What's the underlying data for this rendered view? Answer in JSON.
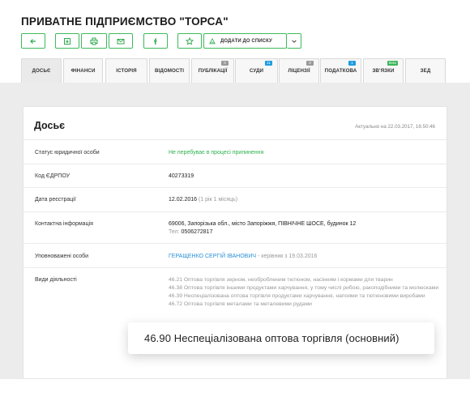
{
  "page": {
    "title": "ПРИВАТНЕ ПІДПРИЄМСТВО \"ТОРСА\""
  },
  "toolbar": {
    "add_to_list": "ДОДАТИ ДО СПИСКУ",
    "icons": [
      "back-arrow-icon",
      "download-icon",
      "print-icon",
      "email-icon",
      "facebook-icon",
      "star-icon",
      "list-icon",
      "chevron-down-icon"
    ]
  },
  "tabs": [
    {
      "label": "ДОСЬЄ",
      "active": true
    },
    {
      "label": "ФІНАНСИ"
    },
    {
      "label": "ІСТОРІЯ"
    },
    {
      "label": "ВІДОМОСТІ"
    },
    {
      "label": "ПУБЛІКАЦІЇ",
      "badge": "0"
    },
    {
      "label": "СУДИ",
      "badge": "11"
    },
    {
      "label": "ЛІЦЕНЗІЇ",
      "badge": "0"
    },
    {
      "label": "ПОДАТКОВА",
      "badge": "1"
    },
    {
      "label": "ЗВ'ЯЗКИ",
      "badge": "beta"
    },
    {
      "label": "ЗЕД"
    }
  ],
  "dossier": {
    "title": "Досьє",
    "updated": "Актуально на 22.03.2017, 16:50:46",
    "status_label": "Статус юридичної особи",
    "status_value": "Не перебуває в процесі припинення",
    "edrpou_label": "Код ЄДРПОУ",
    "edrpou_value": "40273319",
    "reg_label": "Дата реєстрації",
    "reg_date": "12.02.2016",
    "reg_age": "(1 рік 1 місяць)",
    "contact_label": "Контактна інформація",
    "address": "69006, Запорізька обл., місто Запоріжжя, ПІВНІЧНЕ ШОСЕ, будинок 12",
    "phone_label": "Тел:",
    "phone": "0506272817",
    "persons_label": "Уповноважені особи",
    "person_name": "ГЕРАЩЕНКО СЕРГІЙ ІВАНОВИЧ",
    "person_role": "- керівник з 19.03.2016",
    "activities_label": "Види діяльності",
    "activities": [
      "46.21 Оптова торгівля зерном, необробленим тютюном, насінням і кормами для тварин",
      "46.38 Оптова торгівля іншими продуктами харчування, у тому числі рибою, ракоподібними та молюсками",
      "46.39 Неспеціалізована оптова торгівля продуктами харчування, напоями та тютюновими виробами",
      "46.72 Оптова торгівля металами та металевими рудами"
    ],
    "main_activity": "46.90 Неспеціалізована оптова торгівля (основний)"
  }
}
